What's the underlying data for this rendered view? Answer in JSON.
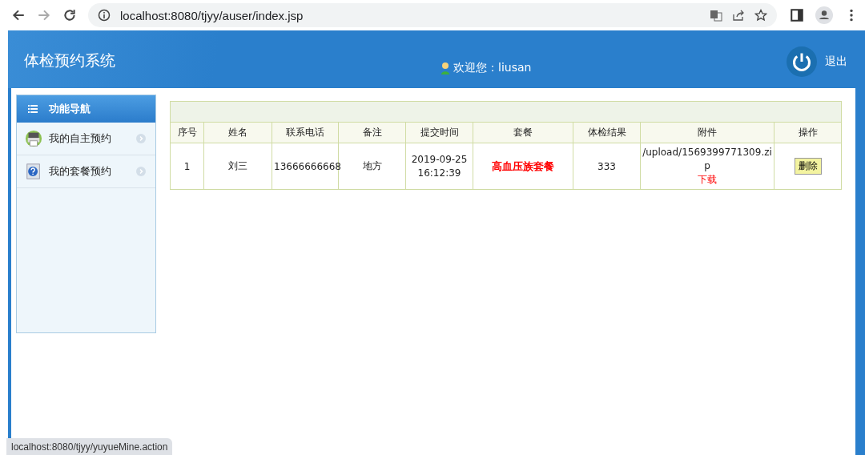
{
  "browser": {
    "url": "localhost:8080/tjyy/auser/index.jsp"
  },
  "header": {
    "title": "体检预约系统",
    "welcome": "欢迎您：liusan",
    "logout": "退出"
  },
  "sidebar": {
    "title": "功能导航",
    "items": [
      {
        "label": "我的自主预约",
        "kind": "printer"
      },
      {
        "label": "我的套餐预约",
        "kind": "help"
      }
    ]
  },
  "table": {
    "columns": [
      "序号",
      "姓名",
      "联系电话",
      "备注",
      "提交时间",
      "套餐",
      "体检结果",
      "附件",
      "操作"
    ],
    "rows": [
      {
        "cells": [
          "1",
          "刘三",
          "13666666668",
          "地方",
          "2019-09-25 16:12:39",
          "高血压族套餐",
          "333",
          "/upload/1569399771309.zip"
        ],
        "link": "下载",
        "action": "删除"
      }
    ]
  },
  "status_link": "localhost:8080/tjyy/yuyueMine.action"
}
